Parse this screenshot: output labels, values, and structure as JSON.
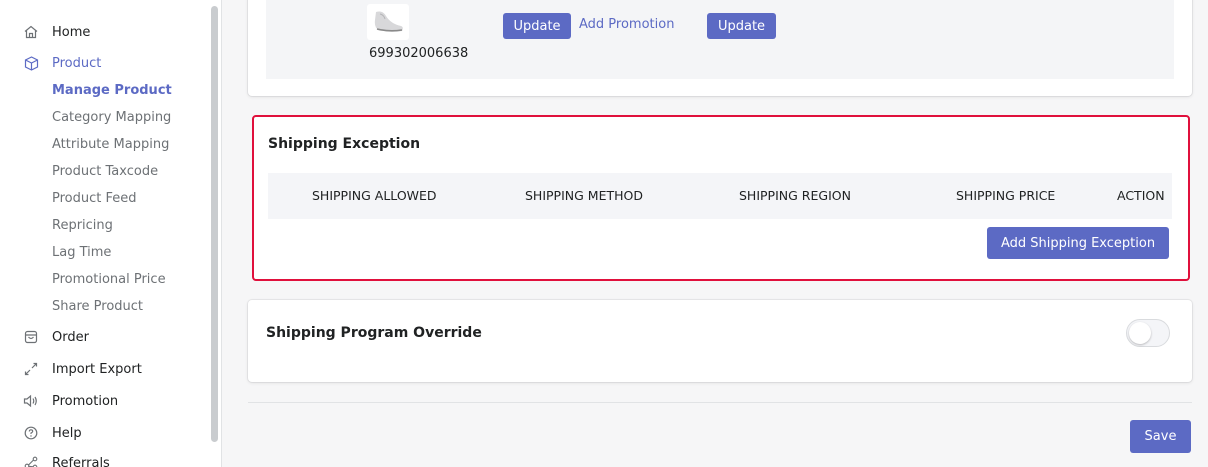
{
  "sidebar": {
    "items": [
      {
        "label": "Home",
        "icon": "home-icon"
      },
      {
        "label": "Product",
        "icon": "box-icon"
      },
      {
        "label": "Order",
        "icon": "bag-icon"
      },
      {
        "label": "Import Export",
        "icon": "arrows-icon"
      },
      {
        "label": "Promotion",
        "icon": "speaker-icon"
      },
      {
        "label": "Help",
        "icon": "question-icon"
      },
      {
        "label": "Referrals",
        "icon": "share-icon"
      }
    ],
    "product_sub": [
      "Manage Product",
      "Category Mapping",
      "Attribute Mapping",
      "Product Taxcode",
      "Product Feed",
      "Repricing",
      "Lag Time",
      "Promotional Price",
      "Share Product"
    ]
  },
  "variant": {
    "sku": "699302006638",
    "update_label": "Update",
    "add_promotion_label": "Add Promotion",
    "update2_label": "Update"
  },
  "shipping_exception": {
    "title": "Shipping Exception",
    "columns": [
      "SHIPPING ALLOWED",
      "SHIPPING METHOD",
      "SHIPPING REGION",
      "SHIPPING PRICE",
      "ACTION"
    ],
    "add_button": "Add Shipping Exception"
  },
  "shipping_program": {
    "title": "Shipping Program Override",
    "enabled": false
  },
  "save_label": "Save",
  "colors": {
    "accent": "#5c6ac4",
    "highlight_border": "#e0103c"
  }
}
